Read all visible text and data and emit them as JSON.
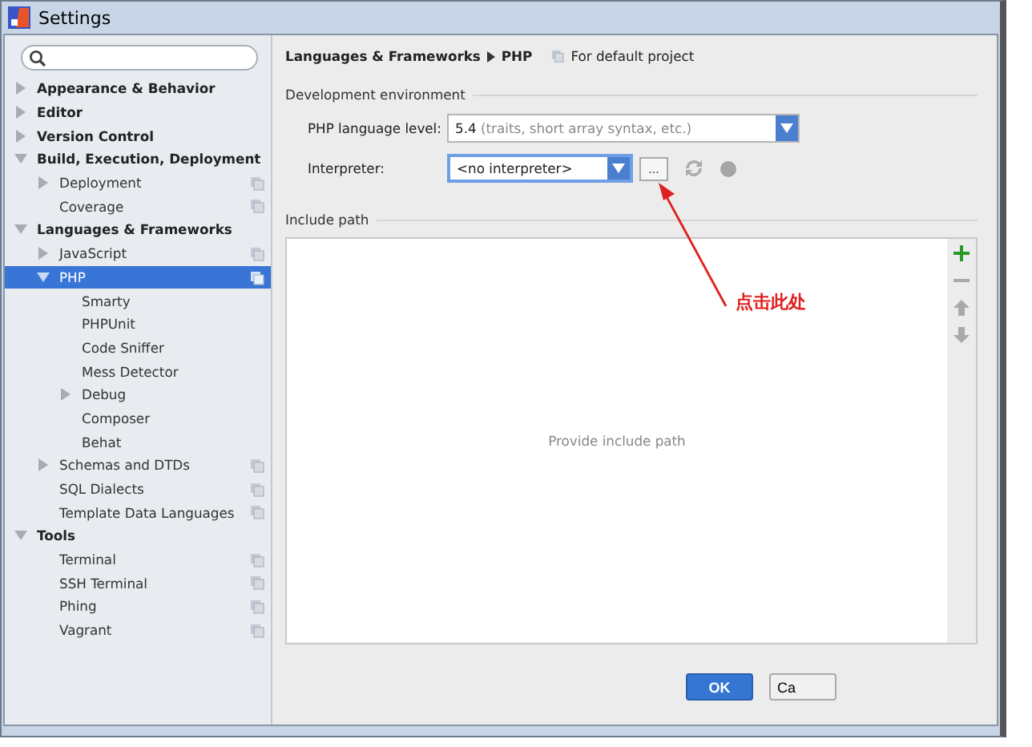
{
  "window": {
    "title": "Settings"
  },
  "sidebar": {
    "items": [
      {
        "label": "Appearance & Behavior",
        "kind": "branch",
        "expanded": false,
        "selected": false,
        "project_scope": false
      },
      {
        "label": "Editor",
        "kind": "branch",
        "expanded": false,
        "selected": false,
        "project_scope": false
      },
      {
        "label": "Version Control",
        "kind": "branch",
        "expanded": false,
        "selected": false,
        "project_scope": false
      },
      {
        "label": "Build, Execution, Deployment",
        "kind": "branch",
        "expanded": true,
        "selected": false,
        "project_scope": false,
        "children": [
          {
            "label": "Deployment",
            "kind": "branch",
            "expanded": false,
            "selected": false,
            "project_scope": true
          },
          {
            "label": "Coverage",
            "kind": "leaf",
            "selected": false,
            "project_scope": true
          }
        ]
      },
      {
        "label": "Languages & Frameworks",
        "kind": "branch",
        "expanded": true,
        "selected": false,
        "project_scope": false,
        "children": [
          {
            "label": "JavaScript",
            "kind": "branch",
            "expanded": false,
            "selected": false,
            "project_scope": true
          },
          {
            "label": "PHP",
            "kind": "branch",
            "expanded": true,
            "selected": true,
            "project_scope": true,
            "children": [
              {
                "label": "Smarty",
                "kind": "leaf",
                "selected": false,
                "project_scope": false
              },
              {
                "label": "PHPUnit",
                "kind": "leaf",
                "selected": false,
                "project_scope": false
              },
              {
                "label": "Code Sniffer",
                "kind": "leaf",
                "selected": false,
                "project_scope": false
              },
              {
                "label": "Mess Detector",
                "kind": "leaf",
                "selected": false,
                "project_scope": false
              },
              {
                "label": "Debug",
                "kind": "branch",
                "expanded": false,
                "selected": false,
                "project_scope": false
              },
              {
                "label": "Composer",
                "kind": "leaf",
                "selected": false,
                "project_scope": false
              },
              {
                "label": "Behat",
                "kind": "leaf",
                "selected": false,
                "project_scope": false
              }
            ]
          },
          {
            "label": "Schemas and DTDs",
            "kind": "branch",
            "expanded": false,
            "selected": false,
            "project_scope": true
          },
          {
            "label": "SQL Dialects",
            "kind": "leaf",
            "selected": false,
            "project_scope": true
          },
          {
            "label": "Template Data Languages",
            "kind": "leaf",
            "selected": false,
            "project_scope": true
          }
        ]
      },
      {
        "label": "Tools",
        "kind": "branch",
        "expanded": true,
        "selected": false,
        "project_scope": false,
        "children": [
          {
            "label": "Terminal",
            "kind": "leaf",
            "selected": false,
            "project_scope": true
          },
          {
            "label": "SSH Terminal",
            "kind": "leaf",
            "selected": false,
            "project_scope": true
          },
          {
            "label": "Phing",
            "kind": "leaf",
            "selected": false,
            "project_scope": true
          },
          {
            "label": "Vagrant",
            "kind": "leaf",
            "selected": false,
            "project_scope": true
          }
        ]
      }
    ]
  },
  "header": {
    "breadcrumb": [
      "Languages & Frameworks",
      "PHP"
    ],
    "scope": "For default project"
  },
  "development_environment": {
    "title": "Development environment",
    "language_level": {
      "label": "PHP language level:",
      "value": "5.4",
      "hint": "(traits, short array syntax, etc.)",
      "focused": false
    },
    "interpreter": {
      "label": "Interpreter:",
      "value": "<no interpreter>",
      "focused": true,
      "browse": "..."
    }
  },
  "include_path": {
    "title": "Include path",
    "empty_text": "Provide include path",
    "toolbar": [
      {
        "kind": "add",
        "disabled": false
      },
      {
        "kind": "remove",
        "disabled": true
      },
      {
        "kind": "up",
        "disabled": true
      },
      {
        "kind": "down",
        "disabled": true
      }
    ]
  },
  "annotation": {
    "text": "点击此处"
  },
  "buttons": [
    {
      "label": "OK",
      "default": true
    },
    {
      "label": "Ca",
      "default": false
    }
  ]
}
